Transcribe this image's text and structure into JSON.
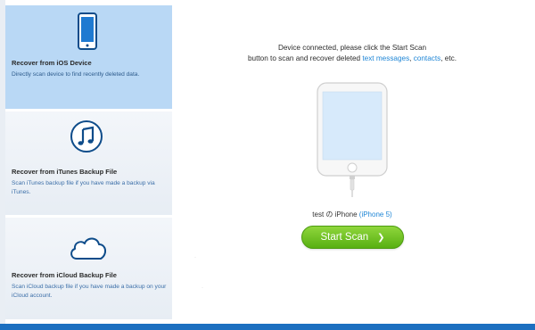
{
  "sidebar": {
    "items": [
      {
        "title": "Recover from iOS Device",
        "desc": "Directly scan device to find recently deleted data.",
        "icon": "phone-icon"
      },
      {
        "title": "Recover from iTunes Backup File",
        "desc": "Scan iTunes backup file if you have made a backup via iTunes.",
        "icon": "music-note-icon"
      },
      {
        "title": "Recover from iCloud Backup File",
        "desc": "Scan iCloud backup file if you have made a backup on your iCloud account.",
        "icon": "cloud-icon"
      }
    ]
  },
  "main": {
    "message_line1": "Device connected, please click the Start Scan",
    "message_line2_prefix": "button to scan and recover deleted",
    "link_text_messages": "text messages",
    "comma": ",",
    "link_contacts": "contacts",
    "message_suffix": ", etc.",
    "device_name": "test の iPhone",
    "device_model": "(iPhone 5)",
    "start_button": "Start Scan"
  },
  "colors": {
    "active_item": "#b9d8f5",
    "link": "#1f86d6",
    "button_green": "#6cc220",
    "frame_blue": "#1c6fc0"
  }
}
